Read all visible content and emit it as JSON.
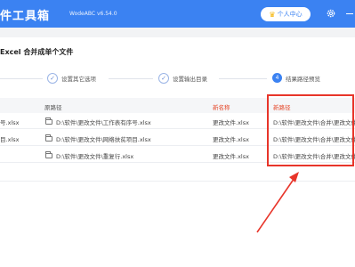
{
  "header": {
    "title": "件工具箱",
    "version": "WodeABC v6.54.0",
    "user_button": "个人中心"
  },
  "page_title": "Excel 合并成单个文件",
  "steps": [
    {
      "label": "设置其它选项",
      "state": "done"
    },
    {
      "label": "设置输出目录",
      "state": "done"
    },
    {
      "number": "4",
      "label": "结果路径预览",
      "state": "active"
    }
  ],
  "table": {
    "columns": {
      "original_path": "原路径",
      "new_name": "新名称",
      "new_path": "新路径"
    },
    "rows": [
      {
        "name": "号.xlsx",
        "original_path": "D:\\软件\\更改文件\\工作表有序号.xlsx",
        "new_name": "更改文件.xlsx",
        "new_path": "D:\\软件\\更改文件\\合并\\更改文件.xlsx"
      },
      {
        "name": "目.xlsx",
        "original_path": "D:\\软件\\更改文件\\网络扶贫项目.xlsx",
        "new_name": "更改文件.xlsx",
        "new_path": "D:\\软件\\更改文件\\合并\\更改文件.xlsx"
      },
      {
        "name": "",
        "original_path": "D:\\软件\\更改文件\\重复行.xlsx",
        "new_name": "更改文件.xlsx",
        "new_path": "D:\\软件\\更改文件\\合并\\更改文件.xlsx"
      }
    ]
  },
  "colors": {
    "primary": "#3b82f2",
    "highlight": "#e8352a",
    "crown": "#f5b301"
  },
  "icons": [
    "crown-icon",
    "gear-icon",
    "check-circle-icon",
    "folder-icon"
  ]
}
